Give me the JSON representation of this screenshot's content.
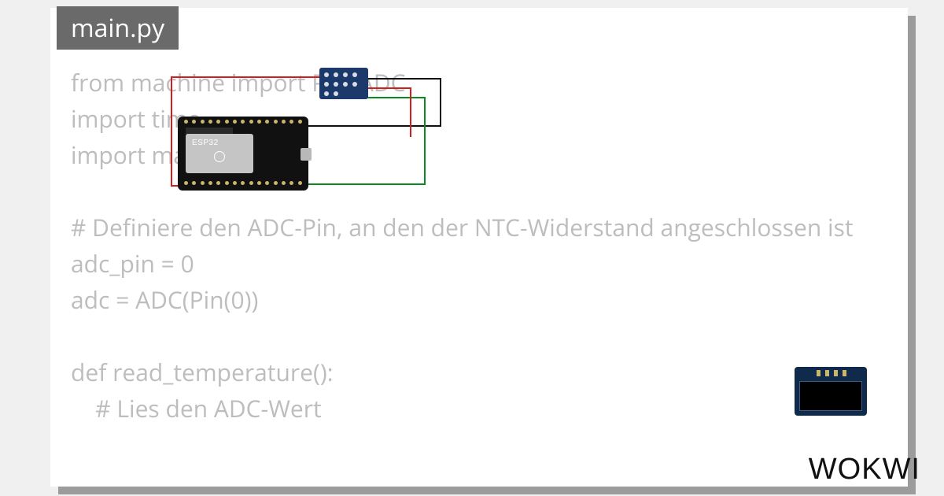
{
  "tab": {
    "filename": "main.py"
  },
  "code": {
    "lines": [
      "from machine import Pin, ADC",
      "import time",
      "import math",
      "",
      "# Definiere den ADC-Pin, an den der NTC-Widerstand angeschlossen ist",
      "adc_pin = 0",
      "adc = ADC(Pin(0))",
      "",
      "def read_temperature():",
      "    # Lies den ADC-Wert"
    ]
  },
  "boards": {
    "mcu": {
      "label": "ESP32"
    }
  },
  "brand": "WOKWI",
  "colors": {
    "wire_red": "#d11f1f",
    "wire_black": "#111111",
    "wire_green": "#0a8a1f"
  }
}
